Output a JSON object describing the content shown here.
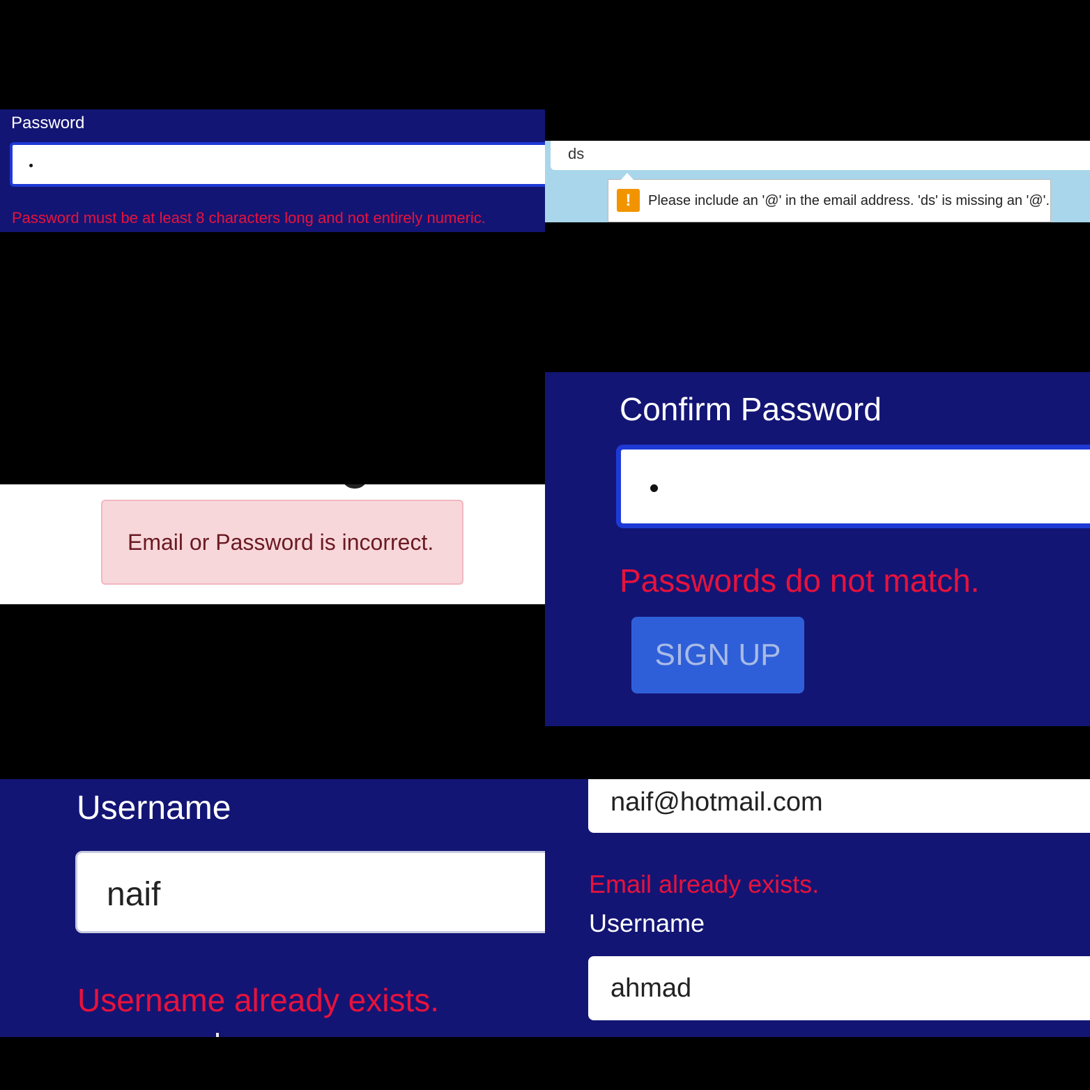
{
  "panel1": {
    "label": "Password",
    "value": "•",
    "error": "Password must be at least 8 characters long and not entirely numeric."
  },
  "panel2": {
    "email_value": "ds",
    "tooltip_icon": "!",
    "tooltip_message": "Please include an '@' in the email address. 'ds' is missing an '@'."
  },
  "panel3": {
    "alert": "Email or Password is incorrect."
  },
  "panel4": {
    "label": "Confirm Password",
    "value": "•",
    "error": "Passwords do not match.",
    "button": "SIGN UP"
  },
  "panel5": {
    "label": "Username",
    "value": "naif",
    "error": "Username already exists."
  },
  "panel6": {
    "email_value": "naif@hotmail.com",
    "email_error": "Email already exists.",
    "username_label": "Username",
    "username_value": "ahmad"
  },
  "colors": {
    "panel_bg": "#131574",
    "error_text": "#e8123c",
    "field_focus_border": "#1e3ad6",
    "button_bg": "#2f5fd8",
    "alert_bg": "#f8d7da",
    "tooltip_icon_bg": "#f29400"
  }
}
